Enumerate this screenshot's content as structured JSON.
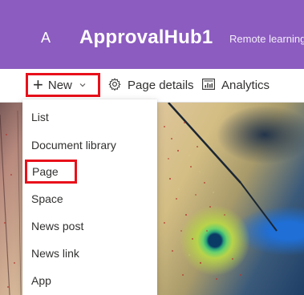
{
  "header": {
    "site_initial": "A",
    "site_title": "ApprovalHub1",
    "nav_link": "Remote learning"
  },
  "commandbar": {
    "new_label": "New",
    "page_details_label": "Page details",
    "analytics_label": "Analytics"
  },
  "new_menu": {
    "items": [
      "List",
      "Document library",
      "Page",
      "Space",
      "News post",
      "News link",
      "App"
    ],
    "highlighted": "Page"
  },
  "colors": {
    "header_bg": "#8c5cc0",
    "highlight_border": "#e8101a",
    "text": "#323130"
  },
  "icons": [
    "plus-icon",
    "chevron-down-icon",
    "gear-icon",
    "analytics-icon"
  ]
}
